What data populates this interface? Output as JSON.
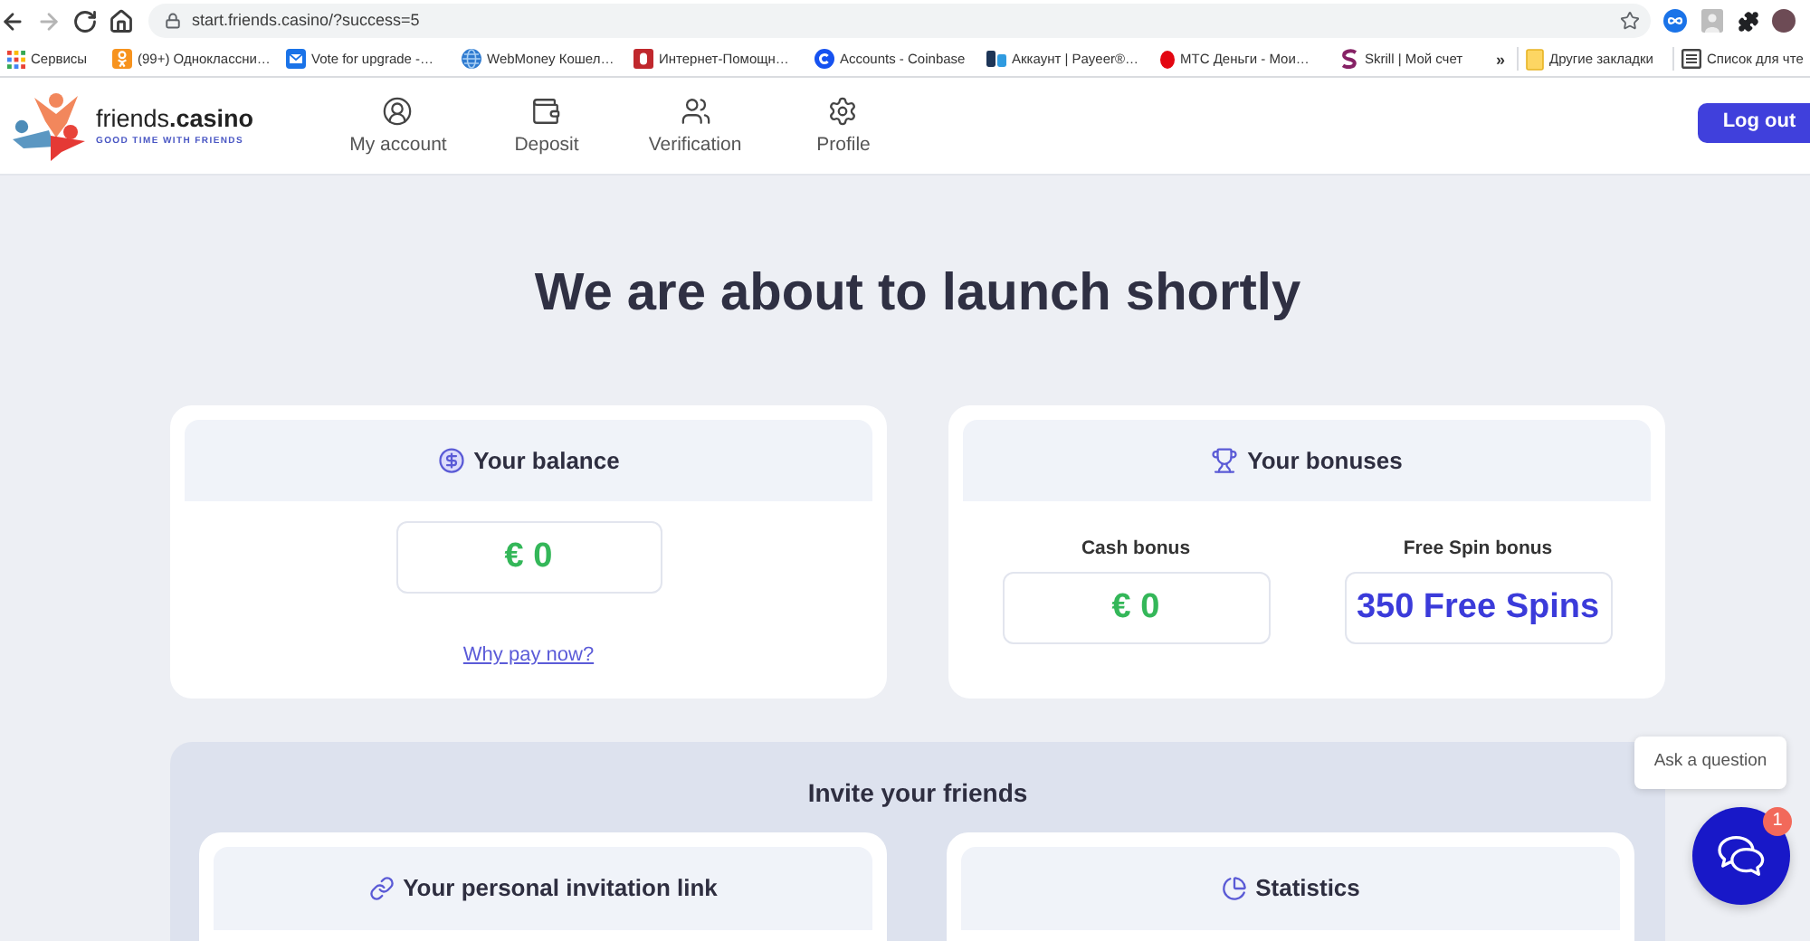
{
  "browser": {
    "nav_buttons": [
      {
        "kind": "back",
        "disabled": false
      },
      {
        "kind": "forward",
        "disabled": true
      },
      {
        "kind": "reload",
        "disabled": false
      },
      {
        "kind": "home",
        "disabled": false
      }
    ],
    "url": "start.friends.casino/?success=5",
    "bookmarks_bar": {
      "apps": "Сервисы",
      "items": [
        "(99+) Одноклассни…",
        "Vote for upgrade -…",
        "WebMoney Кошел…",
        "Интернет-Помощн…",
        "Accounts - Coinbase",
        "Аккаунт | Payeer®…",
        "МТС Деньги - Мои…",
        "Skrill | Мой счет"
      ],
      "more": "»",
      "other_bookmarks": "Другие закладки",
      "reading_list": "Список для чте"
    }
  },
  "header": {
    "logo": {
      "name": "friends**.casino**",
      "tagline": "GOOD TIME WITH FRIENDS"
    },
    "nav": [
      {
        "kind": "account",
        "label": "My account"
      },
      {
        "kind": "deposit",
        "label": "Deposit"
      },
      {
        "kind": "verification",
        "label": "Verification"
      },
      {
        "kind": "profile",
        "label": "Profile"
      }
    ],
    "logout": "Log out"
  },
  "title": "We are about to launch shortly",
  "balance_card": {
    "title": "Your balance",
    "amount": "€ 0",
    "link": "Why pay now?"
  },
  "bonuses_card": {
    "title": "Your bonuses",
    "items": [
      {
        "kind": "money",
        "label": "Cash bonus",
        "value": "€ 0"
      },
      {
        "kind": "spins",
        "label": "Free Spin bonus",
        "value": "350 Free Spins"
      }
    ]
  },
  "invite": {
    "title": "Invite your friends",
    "cards": [
      {
        "kind": "link",
        "title": "Your personal invitation link"
      },
      {
        "kind": "stats",
        "title": "Statistics"
      }
    ]
  },
  "chat": {
    "tooltip": "Ask a question",
    "badge": "1"
  }
}
